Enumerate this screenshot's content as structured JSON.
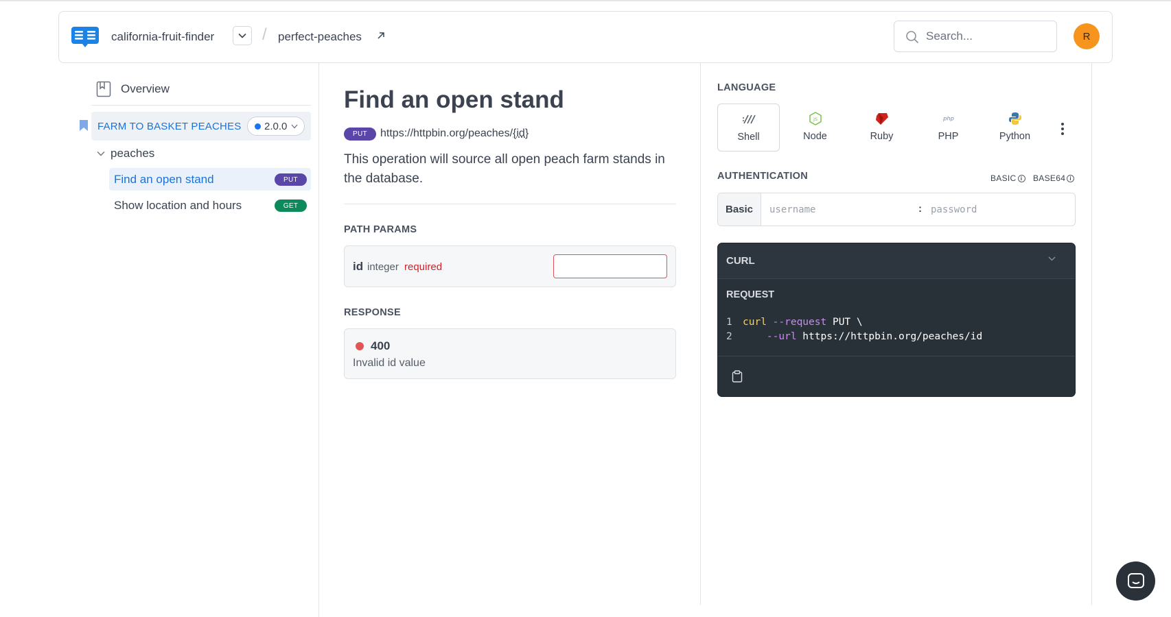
{
  "header": {
    "project_name": "california-fruit-finder",
    "separator": "/",
    "version_name": "perfect-peaches",
    "search_placeholder": "Search...",
    "avatar_initial": "R"
  },
  "sidebar": {
    "overview_label": "Overview",
    "api_name": "FARM TO BASKET PEACHES",
    "api_version": "2.0.0",
    "group_label": "peaches",
    "items": [
      {
        "label": "Find an open stand",
        "method": "PUT",
        "active": true
      },
      {
        "label": "Show location and hours",
        "method": "GET",
        "active": false
      }
    ]
  },
  "main": {
    "title": "Find an open stand",
    "method": "PUT",
    "url_base": "https://httpbin.org/peaches/",
    "url_param": "{id}",
    "description": "This operation will source all open peach farm stands in the database.",
    "path_params_label": "PATH PARAMS",
    "param": {
      "name": "id",
      "type": "integer",
      "required": "required",
      "value": ""
    },
    "response_label": "RESPONSE",
    "response": {
      "code": "400",
      "message": "Invalid id value",
      "status_color": "#e05555"
    }
  },
  "right": {
    "language_label": "LANGUAGE",
    "languages": [
      {
        "label": "Shell",
        "icon": "shell-icon",
        "selected": true
      },
      {
        "label": "Node",
        "icon": "node-icon",
        "selected": false
      },
      {
        "label": "Ruby",
        "icon": "ruby-icon",
        "selected": false
      },
      {
        "label": "PHP",
        "icon": "php-icon",
        "selected": false
      },
      {
        "label": "Python",
        "icon": "python-icon",
        "selected": false
      }
    ],
    "auth_label": "AUTHENTICATION",
    "auth_links": [
      "BASIC",
      "BASE64"
    ],
    "auth_type": "Basic",
    "username_placeholder": "username",
    "password_placeholder": "password",
    "auth_separator": ":",
    "code_header": "CURL",
    "request_label": "REQUEST",
    "code": {
      "line1_num": "1",
      "line1_cmd": "curl",
      "line1_flag": "--request",
      "line1_rest": " PUT \\",
      "line2_num": "2",
      "line2_flag": "--url",
      "line2_rest": " https://httpbin.org/peaches/id"
    }
  },
  "colors": {
    "accent": "#1a73d9",
    "put_badge": "#5a46a8",
    "get_badge": "#0c8a5b",
    "avatar": "#f7941d",
    "code_bg": "#283038"
  }
}
